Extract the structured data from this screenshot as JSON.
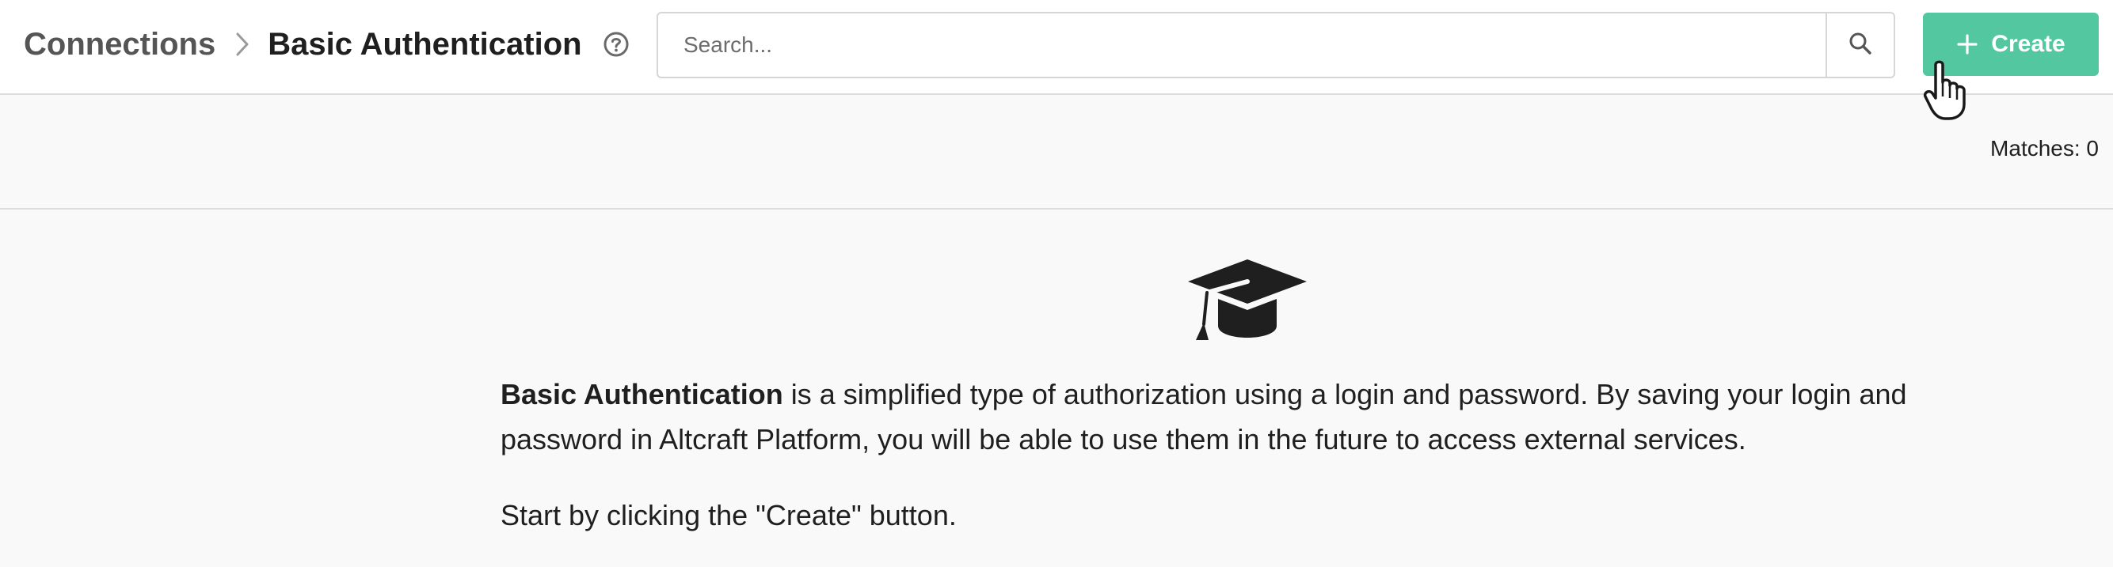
{
  "breadcrumb": {
    "parent": "Connections",
    "current": "Basic Authentication"
  },
  "search": {
    "placeholder": "Search..."
  },
  "toolbar": {
    "create_label": "Create"
  },
  "results": {
    "matches_text": "Matches: 0"
  },
  "empty_state": {
    "icon": "graduation-cap-icon",
    "title_bold": "Basic Authentication",
    "description": " is a simplified type of authorization using a login and password. By saving your login and password in Altcraft Platform, you will be able to use them in the future to access external services.",
    "hint": "Start by clicking the \"Create\" button."
  },
  "colors": {
    "accent": "#52c7a0",
    "background": "#f9f9f9",
    "header_background": "#ffffff",
    "text": "#1f1f1f",
    "muted_text": "#555555"
  }
}
